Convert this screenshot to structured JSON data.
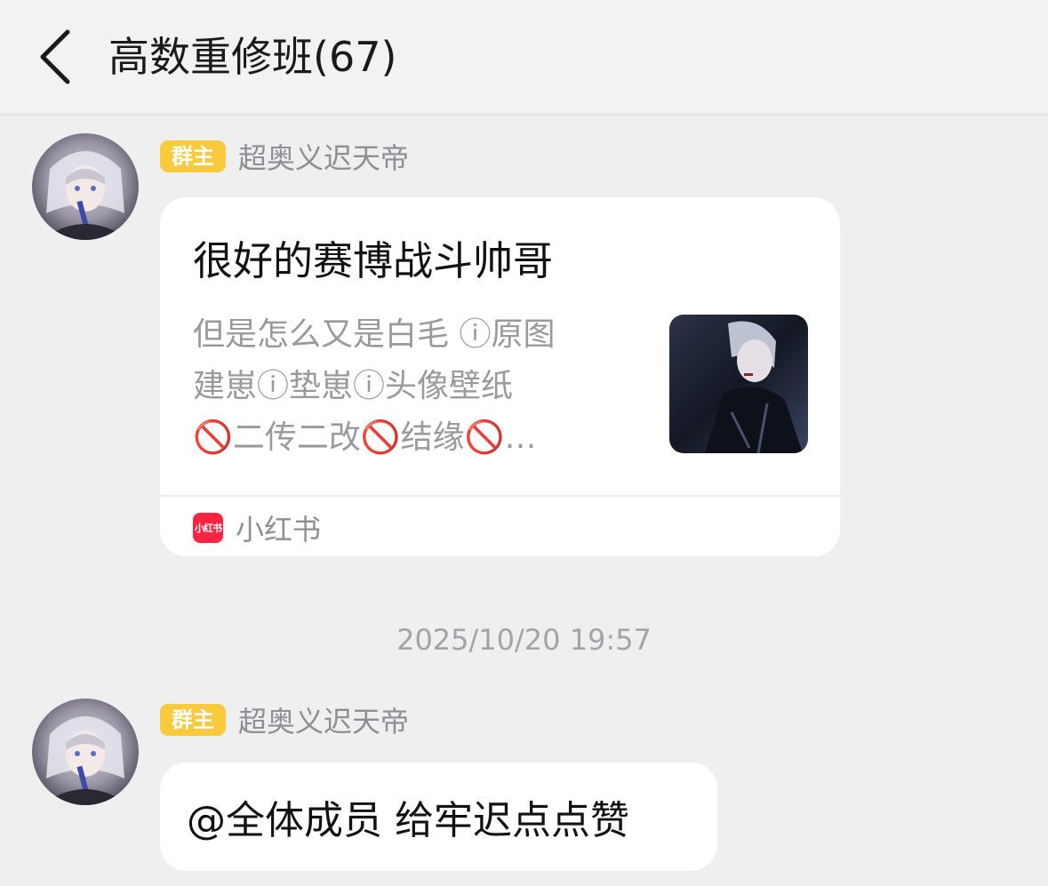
{
  "header": {
    "back_icon": "chevron-left-icon",
    "title": "高数重修班(67)"
  },
  "messages": [
    {
      "sender": {
        "role_badge": "群主",
        "name": "超奥义迟天帝",
        "avatar_icon": "avatar"
      },
      "card": {
        "title": "很好的赛博战斗帅哥",
        "description": "但是怎么又是白毛 ⓘ原图\n建崽ⓘ垫崽ⓘ头像壁纸\n🚫二传二改🚫结缘🚫…",
        "thumbnail_icon": "thumbnail-image",
        "source_icon_text": "小红书",
        "source_name": "小红书"
      }
    },
    {
      "sender": {
        "role_badge": "群主",
        "name": "超奥义迟天帝",
        "avatar_icon": "avatar"
      },
      "text": "@全体成员 给牢迟点点赞"
    }
  ],
  "timestamp": "2025/10/20 19:57",
  "colors": {
    "background": "#efeff0",
    "badge": "#f9c93e",
    "source_brand": "#ff2442",
    "bubble": "#ffffff"
  }
}
